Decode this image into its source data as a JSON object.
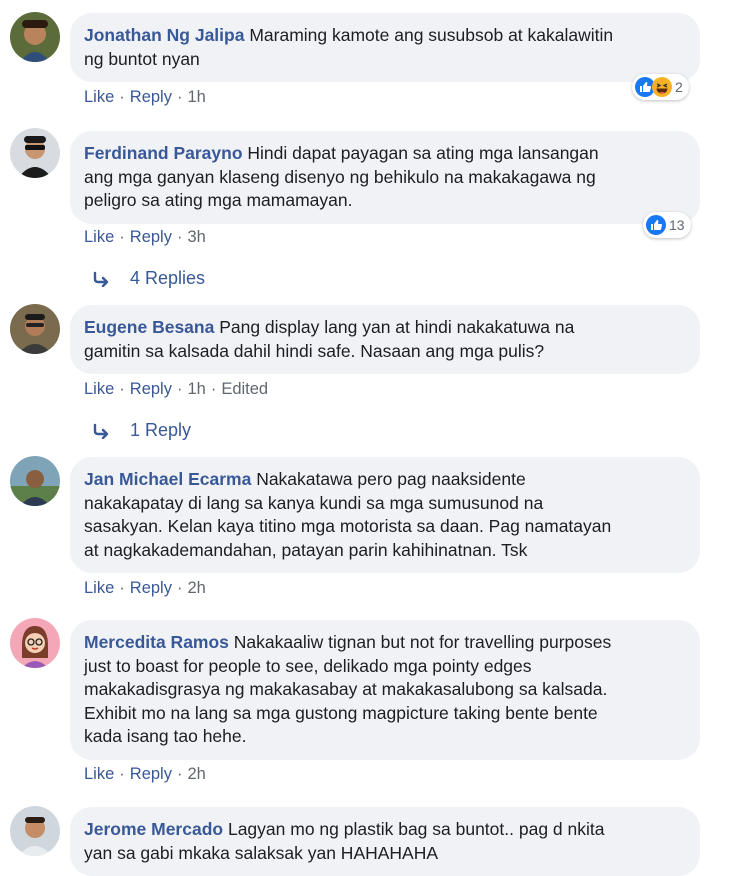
{
  "comments": [
    {
      "author": "Jonathan Ng Jalipa",
      "text": "Maraming kamote ang susubsob at kakalawitin\nng buntot nyan",
      "actions": {
        "like": "Like",
        "reply": "Reply",
        "time": "1h"
      },
      "reactions": {
        "icons": [
          "like-icon",
          "haha-icon"
        ],
        "count": "2"
      }
    },
    {
      "author": "Ferdinand Parayno",
      "text": "Hindi dapat payagan sa ating mga lansangan\nang mga ganyan klaseng disenyo ng behikulo na makakagawa ng\npeligro sa ating mga mamamayan.",
      "actions": {
        "like": "Like",
        "reply": "Reply",
        "time": "3h"
      },
      "reactions": {
        "icons": [
          "like-icon"
        ],
        "count": "13"
      },
      "replies": "4 Replies"
    },
    {
      "author": "Eugene Besana",
      "text": "Pang display lang yan at hindi nakakatuwa na\ngamitin sa kalsada dahil hindi safe. Nasaan ang mga pulis?",
      "actions": {
        "like": "Like",
        "reply": "Reply",
        "time": "1h",
        "edited": "Edited"
      },
      "replies": "1 Reply"
    },
    {
      "author": "Jan Michael Ecarma",
      "text": "Nakakatawa pero pag naaksidente\nnakakapatay di lang sa kanya kundi sa mga sumusunod na\nsasakyan. Kelan kaya titino mga motorista sa daan. Pag namatayan\nat nagkakademandahan, patayan parin kahihinatnan. Tsk",
      "actions": {
        "like": "Like",
        "reply": "Reply",
        "time": "2h"
      }
    },
    {
      "author": "Mercedita Ramos",
      "text": "Nakakaaliw tignan but not for travelling purposes\njust to boast for people to see, delikado mga pointy edges\nmakakadisgrasya ng makakasabay at makakasalubong sa kalsada.\nExhibit mo na lang sa mga gustong magpicture taking bente bente\nkada isang tao hehe.",
      "actions": {
        "like": "Like",
        "reply": "Reply",
        "time": "2h"
      }
    },
    {
      "author": "Jerome Mercado",
      "text": "Lagyan mo ng plastik bag sa buntot.. pag d nkita\nyan sa gabi mkaka salaksak yan HAHAHAHA"
    }
  ],
  "colors": {
    "link": "#385898",
    "bubble": "#f0f2f5",
    "meta": "#606770",
    "like_blue": "#1877f2",
    "haha_yellow": "#f7b125"
  }
}
